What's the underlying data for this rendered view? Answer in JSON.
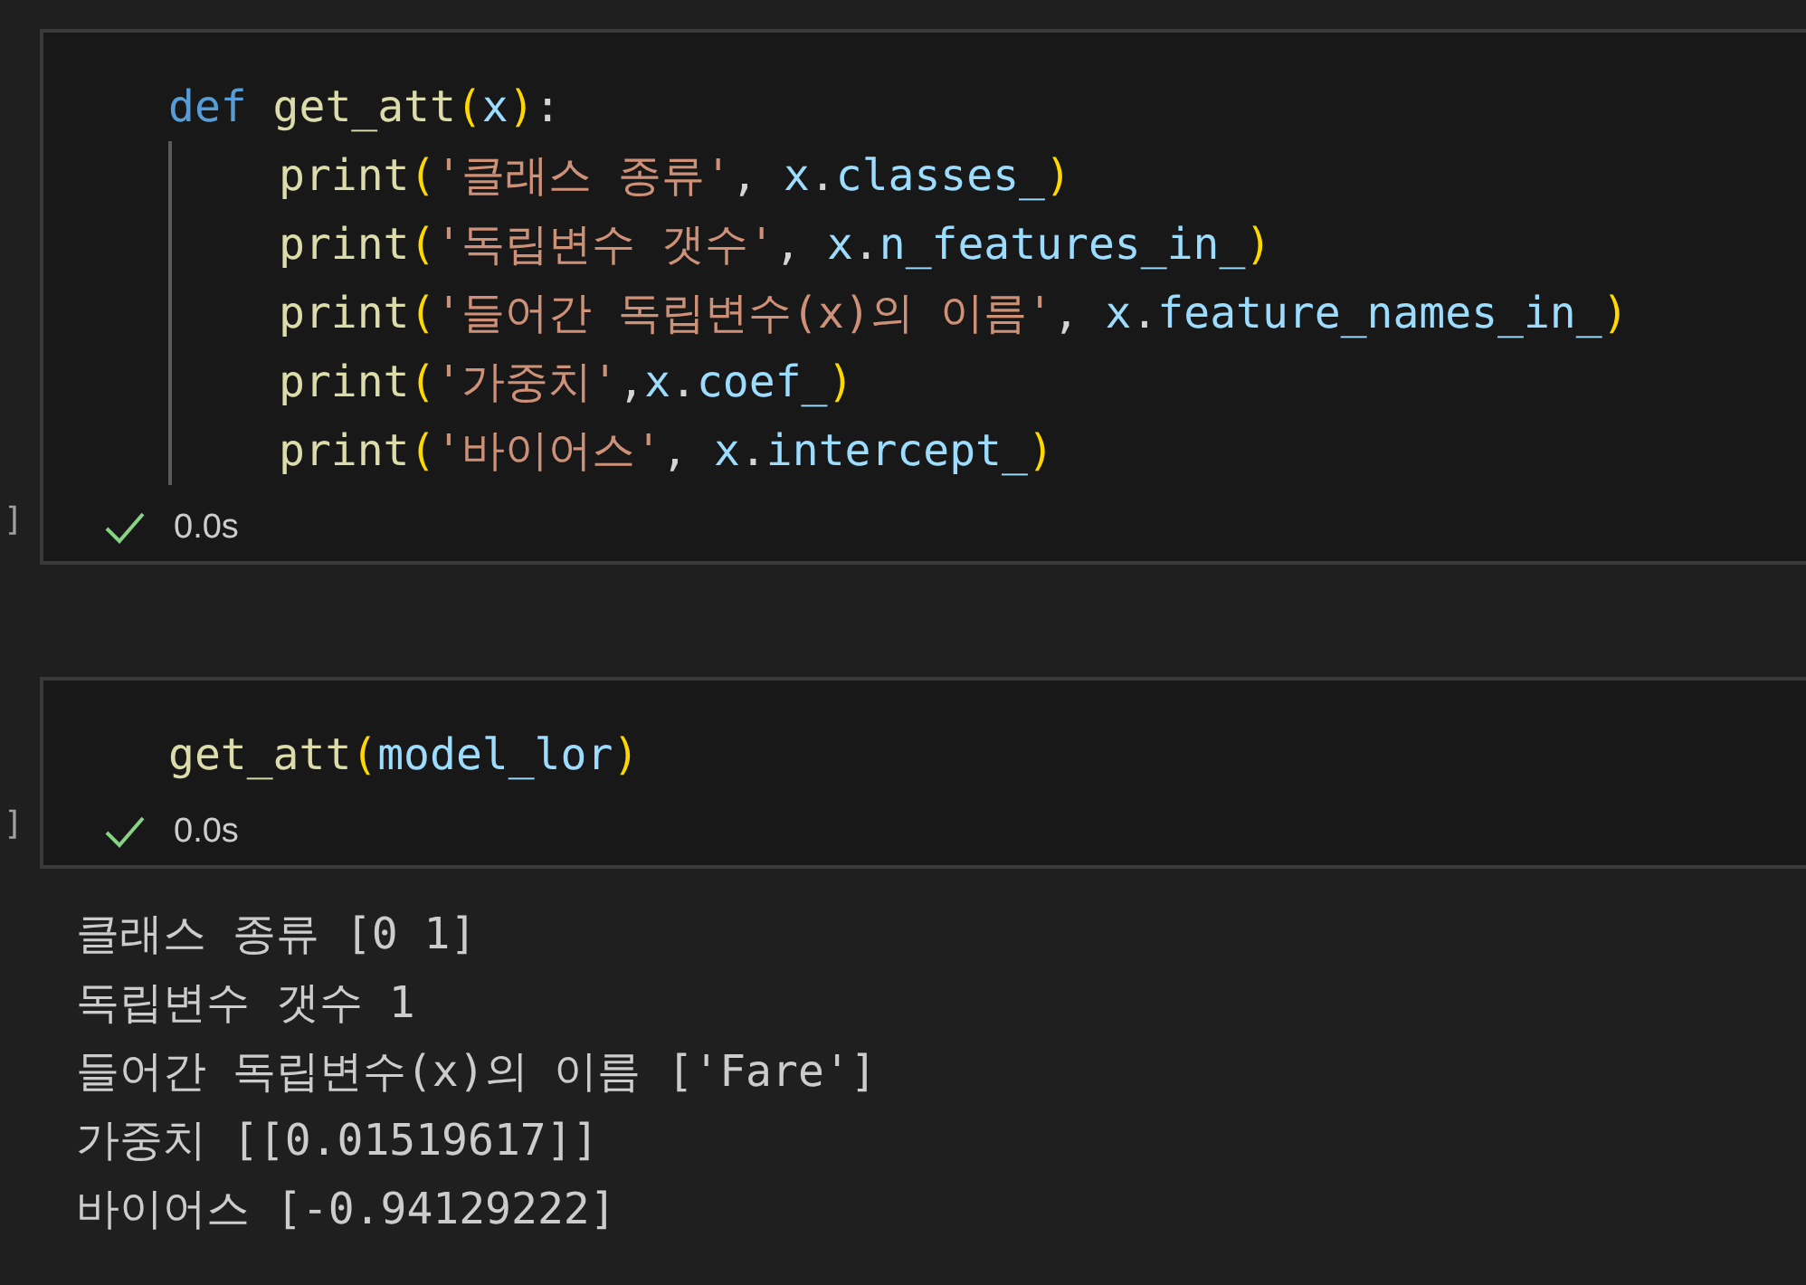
{
  "cells": [
    {
      "execution_label": "]",
      "succeeded": true,
      "time": "0.0s",
      "code": [
        {
          "tokens": [
            {
              "kind": "keyword",
              "text": "def "
            },
            {
              "kind": "function",
              "text": "get_att"
            },
            {
              "kind": "paren",
              "text": "("
            },
            {
              "kind": "variable",
              "text": "x"
            },
            {
              "kind": "paren",
              "text": ")"
            },
            {
              "kind": "plain",
              "text": ":"
            }
          ],
          "children": [
            {
              "tokens": [
                {
                  "kind": "function",
                  "text": "print"
                },
                {
                  "kind": "paren",
                  "text": "("
                },
                {
                  "kind": "string",
                  "text": "'클래스 종류'"
                },
                {
                  "kind": "plain",
                  "text": ", "
                },
                {
                  "kind": "variable",
                  "text": "x"
                },
                {
                  "kind": "plain",
                  "text": "."
                },
                {
                  "kind": "variable",
                  "text": "classes_"
                },
                {
                  "kind": "paren",
                  "text": ")"
                }
              ]
            },
            {
              "tokens": [
                {
                  "kind": "function",
                  "text": "print"
                },
                {
                  "kind": "paren",
                  "text": "("
                },
                {
                  "kind": "string",
                  "text": "'독립변수 갯수'"
                },
                {
                  "kind": "plain",
                  "text": ", "
                },
                {
                  "kind": "variable",
                  "text": "x"
                },
                {
                  "kind": "plain",
                  "text": "."
                },
                {
                  "kind": "variable",
                  "text": "n_features_in_"
                },
                {
                  "kind": "paren",
                  "text": ")"
                }
              ]
            },
            {
              "tokens": [
                {
                  "kind": "function",
                  "text": "print"
                },
                {
                  "kind": "paren",
                  "text": "("
                },
                {
                  "kind": "string",
                  "text": "'들어간 독립변수(x)의 이름'"
                },
                {
                  "kind": "plain",
                  "text": ", "
                },
                {
                  "kind": "variable",
                  "text": "x"
                },
                {
                  "kind": "plain",
                  "text": "."
                },
                {
                  "kind": "variable",
                  "text": "feature_names_in_"
                },
                {
                  "kind": "paren",
                  "text": ")"
                }
              ]
            },
            {
              "tokens": [
                {
                  "kind": "function",
                  "text": "print"
                },
                {
                  "kind": "paren",
                  "text": "("
                },
                {
                  "kind": "string",
                  "text": "'가중치'"
                },
                {
                  "kind": "plain",
                  "text": ","
                },
                {
                  "kind": "variable",
                  "text": "x"
                },
                {
                  "kind": "plain",
                  "text": "."
                },
                {
                  "kind": "variable",
                  "text": "coef_"
                },
                {
                  "kind": "paren",
                  "text": ")"
                }
              ]
            },
            {
              "tokens": [
                {
                  "kind": "function",
                  "text": "print"
                },
                {
                  "kind": "paren",
                  "text": "("
                },
                {
                  "kind": "string",
                  "text": "'바이어스'"
                },
                {
                  "kind": "plain",
                  "text": ", "
                },
                {
                  "kind": "variable",
                  "text": "x"
                },
                {
                  "kind": "plain",
                  "text": "."
                },
                {
                  "kind": "variable",
                  "text": "intercept_"
                },
                {
                  "kind": "paren",
                  "text": ")"
                }
              ]
            }
          ]
        }
      ]
    },
    {
      "execution_label": "]",
      "succeeded": true,
      "time": "0.0s",
      "code": [
        {
          "tokens": [
            {
              "kind": "function",
              "text": "get_att"
            },
            {
              "kind": "paren",
              "text": "("
            },
            {
              "kind": "variable",
              "text": "model_lor"
            },
            {
              "kind": "paren",
              "text": ")"
            }
          ]
        }
      ],
      "output": [
        "클래스 종류 [0 1]",
        "독립변수 갯수 1",
        "들어간 독립변수(x)의 이름 ['Fare']",
        "가중치 [[0.01519617]]",
        "바이어스 [-0.94129222]"
      ]
    }
  ]
}
